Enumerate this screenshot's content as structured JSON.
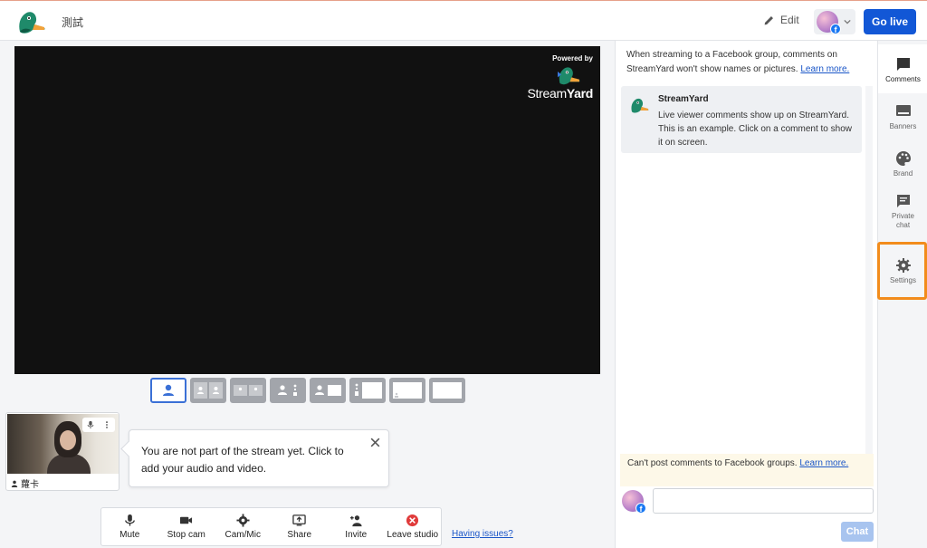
{
  "header": {
    "studio_name": "測試",
    "edit_label": "Edit",
    "golive_label": "Go live",
    "fb_badge": "f"
  },
  "stage": {
    "powered_by": "Powered by",
    "brand_a": "Stream",
    "brand_b": "Yard"
  },
  "layouts": [
    "solo",
    "group",
    "group-small",
    "cropped",
    "picture-in-picture",
    "side-by-side",
    "screen-small",
    "screen-only"
  ],
  "participant": {
    "name": "蘿卡"
  },
  "callout": {
    "text": "You are not part of the stream yet. Click to add your audio and video."
  },
  "toolbar": {
    "mute": "Mute",
    "stop_cam": "Stop cam",
    "cam_mic": "Cam/Mic",
    "share": "Share",
    "invite": "Invite",
    "leave": "Leave studio",
    "having_issues": "Having issues?"
  },
  "comments": {
    "notice_text": "When streaming to a Facebook group, comments on StreamYard won't show names or pictures.",
    "learn_more": "Learn more.",
    "sample_name": "StreamYard",
    "sample_text": "Live viewer comments show up on StreamYard. This is an example. Click on a comment to show it on screen.",
    "cant_post_text": "Can't post comments to Facebook groups.",
    "cant_post_link": "Learn more.",
    "chat_placeholder": "",
    "chat_button": "Chat"
  },
  "rail": {
    "comments": "Comments",
    "banners": "Banners",
    "brand": "Brand",
    "private_chat": "Private chat",
    "settings": "Settings"
  },
  "colors": {
    "accent": "#1257d6",
    "highlight": "#f28c1c",
    "stage_bg": "#111111"
  }
}
